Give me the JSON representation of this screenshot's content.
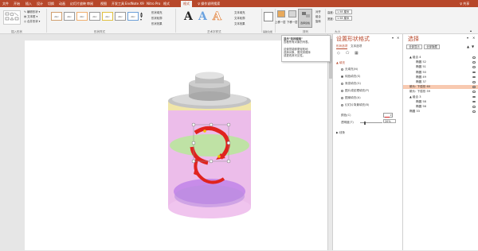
{
  "tabs": [
    "文件",
    "开始",
    "插入",
    "设计",
    "切换",
    "动画",
    "幻灯片放映",
    "审阅",
    "视图",
    "开发工具",
    "EndNote X9",
    "Nitro Pro",
    "格式",
    "格式",
    "♀ 操作说明搜索",
    "♀ 共享"
  ],
  "ribbon": {
    "shape_fill": "形状填充",
    "shape_outline": "形状轮廓",
    "shape_effects": "形状效果",
    "text_fill": "文本填充",
    "text_outline": "文本轮廓",
    "text_effects": "文本效果",
    "style_sample": "Abc",
    "wordart_sample": "A",
    "bring_forward": "上移一层",
    "send_backward": "下移一层",
    "selection_pane": "选择窗格",
    "align": "对齐",
    "group": "组合",
    "rotate": "旋转",
    "height_label": "高度:",
    "height_value": "1.58 厘米",
    "width_label": "宽度:",
    "width_value": "1.58 厘米",
    "groups": [
      "插入形状",
      "形状样式",
      "艺术字样式",
      "辅助功能",
      "排列",
      "大小"
    ]
  },
  "tooltip": {
    "lines": [
      "显示\"选择窗格\"",
      "查看所有对象的列表。",
      "",
      "这使您能够更轻松地",
      "选择对象、更改其顺序",
      "或更改其可见性。"
    ]
  },
  "format_pane": {
    "title": "设置形状格式",
    "tabs": [
      "形状选项",
      "文本选项"
    ],
    "fill_section": "▲ 填充",
    "options": [
      "无填充(N)",
      "纯色填充(S)",
      "渐变填充(G)",
      "图片或纹理填充(P)",
      "图案填充(A)",
      "幻灯片背景填充(B)"
    ],
    "selected_option": 1,
    "color_label": "颜色(C)",
    "transparency_label": "透明度(T)",
    "transparency_value": "20%",
    "line_section": "▶ 线条",
    "fill_color": "#d42020"
  },
  "selection_pane": {
    "title": "选择",
    "show_all": "全部显示",
    "hide_all": "全部隐藏",
    "items": [
      {
        "name": "▲ 组合 4",
        "indent": 0,
        "selected": false
      },
      {
        "name": "椭圆 52",
        "indent": 1,
        "selected": false
      },
      {
        "name": "椭圆 51",
        "indent": 1,
        "selected": false
      },
      {
        "name": "椭圆 50",
        "indent": 1,
        "selected": false
      },
      {
        "name": "椭圆 49",
        "indent": 1,
        "selected": false
      },
      {
        "name": "椭圆 37",
        "indent": 1,
        "selected": false
      },
      {
        "name": "箭头: 下弧形 60",
        "indent": 0,
        "selected": true
      },
      {
        "name": "箭头: 下弧形 59",
        "indent": 0,
        "selected": false
      },
      {
        "name": "▲ 组合 3",
        "indent": 0,
        "selected": false
      },
      {
        "name": "椭圆 58",
        "indent": 1,
        "selected": false
      },
      {
        "name": "椭圆 56",
        "indent": 1,
        "selected": false
      },
      {
        "name": "椭圆 33",
        "indent": 0,
        "selected": false
      }
    ]
  },
  "colors": {
    "accent": "#b7472a",
    "selected_row": "#f8c9b0",
    "battery_glass": "#e9a7e6",
    "battery_liquid": "#c78ce9",
    "band": "#b7e3a6",
    "arrow": "#e0231e",
    "cap": "#b0b0b0"
  }
}
